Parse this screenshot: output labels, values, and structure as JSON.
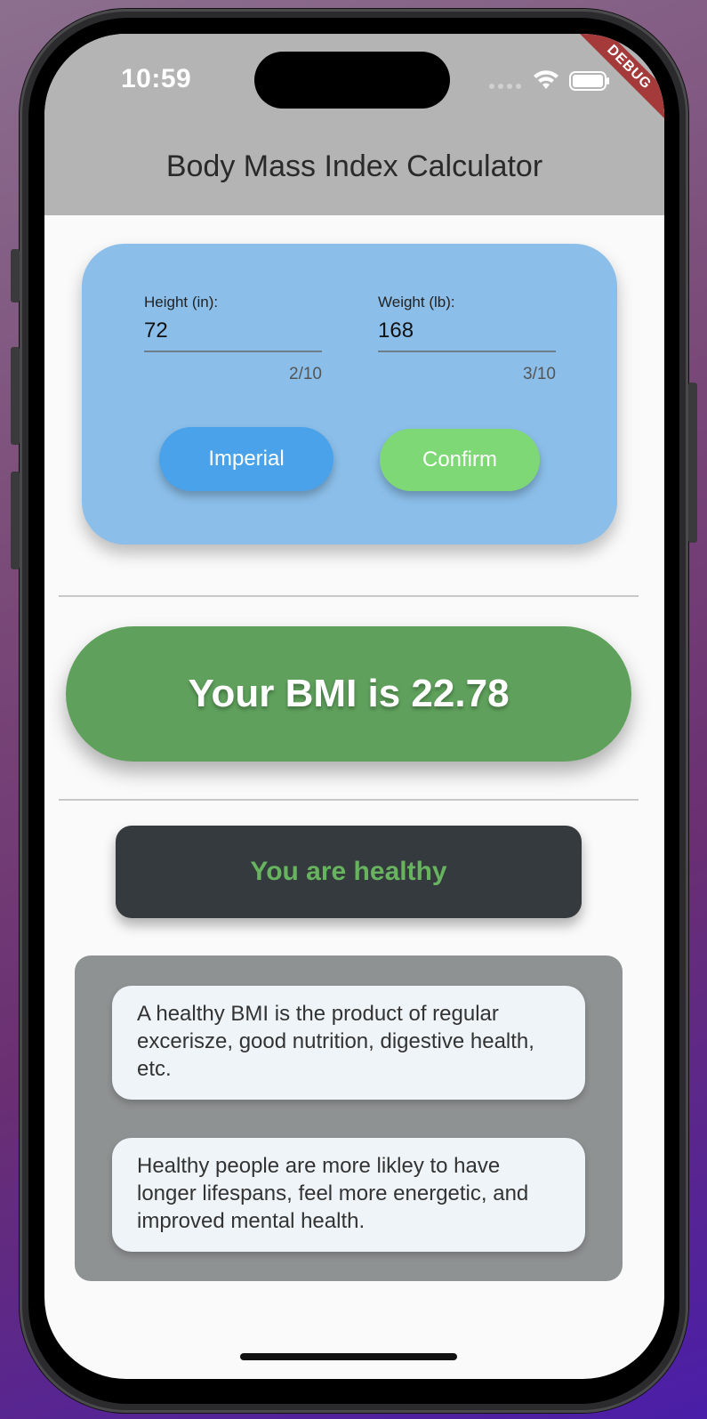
{
  "status_bar": {
    "time": "10:59",
    "debug_label": "DEBUG"
  },
  "app_bar": {
    "title": "Body Mass Index Calculator"
  },
  "inputs": {
    "height": {
      "label": "Height (in):",
      "value": "72",
      "counter": "2/10"
    },
    "weight": {
      "label": "Weight (lb):",
      "value": "168",
      "counter": "3/10"
    }
  },
  "buttons": {
    "imperial": "Imperial",
    "confirm": "Confirm"
  },
  "result": {
    "bmi_text": "Your BMI is 22.78",
    "status_text": "You are healthy"
  },
  "info": [
    "A healthy BMI is the product of regular excerisze, good nutrition, digestive health, etc.",
    "Healthy people are more likley to have longer lifespans, feel more energetic, and improved mental health."
  ],
  "colors": {
    "app_bar": "#b4b4b4",
    "input_card": "#8bbfea",
    "imperial_button": "#4aa3ea",
    "confirm_button": "#7fd876",
    "bmi_pill": "#5fa15c",
    "status_box": "#343a3d",
    "status_text": "#68b35f",
    "info_panel": "#8f9293",
    "info_card": "#eef4f7"
  },
  "icons": [
    "wifi-icon",
    "battery-icon",
    "cellular-signal-icon"
  ]
}
